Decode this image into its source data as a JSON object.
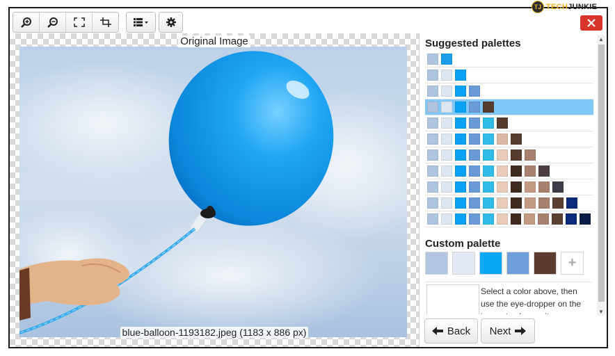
{
  "toolbar": {
    "buttons": [
      {
        "icon": "zoom-in-icon"
      },
      {
        "icon": "zoom-out-icon"
      },
      {
        "icon": "fit-screen-icon"
      },
      {
        "icon": "crop-icon"
      },
      {
        "icon": "list-dropdown-icon"
      },
      {
        "icon": "gear-icon"
      }
    ]
  },
  "logo": {
    "badge": "TJ",
    "text_part1": "TECH",
    "text_part2": "JUNKIE"
  },
  "close_icon": "close-icon",
  "image_panel": {
    "title": "Original Image",
    "caption": "blue-balloon-1193182.jpeg (1183 x 886 px)"
  },
  "suggested": {
    "title": "Suggested palettes",
    "selected_index": 3,
    "rows": [
      [
        "#aec4df",
        "#1d9de9"
      ],
      [
        "#aec4df",
        "#dde6f0",
        "#0ba1f2"
      ],
      [
        "#aec4df",
        "#dde6f0",
        "#0ba1f2",
        "#6a9ad6"
      ],
      [
        "#aec4df",
        "#dde6f0",
        "#0ba1f2",
        "#6a9ad6",
        "#553a2e"
      ],
      [
        "#aec4df",
        "#dde6f0",
        "#0ba1f2",
        "#6a9ad6",
        "#2fbde8",
        "#553a2e"
      ],
      [
        "#aec4df",
        "#dde6f0",
        "#0ba1f2",
        "#6a9ad6",
        "#2fbde8",
        "#dcb9a6",
        "#553a2e"
      ],
      [
        "#aec4df",
        "#dde6f0",
        "#0ba1f2",
        "#6a9ad6",
        "#2fbde8",
        "#e8cbb8",
        "#553a2e",
        "#a8806f"
      ],
      [
        "#aec4df",
        "#dde6f0",
        "#0ba1f2",
        "#6a9ad6",
        "#2fbde8",
        "#e8cbb8",
        "#3f2a20",
        "#a8806f",
        "#4b3f41"
      ],
      [
        "#aec4df",
        "#dde6f0",
        "#0ba1f2",
        "#6a9ad6",
        "#2fbde8",
        "#e8cbb8",
        "#3f2a20",
        "#c39a84",
        "#a8806f",
        "#3e3c48"
      ],
      [
        "#aec4df",
        "#dde6f0",
        "#0ba1f2",
        "#6a9ad6",
        "#2fbde8",
        "#e8cbb8",
        "#3f2a20",
        "#c39a84",
        "#a8806f",
        "#5a4032",
        "#0c2a7a"
      ],
      [
        "#aec4df",
        "#dde6f0",
        "#0ba1f2",
        "#6a9ad6",
        "#2fbde8",
        "#e8cbb8",
        "#3f2a20",
        "#c39a84",
        "#a8806f",
        "#5a4032",
        "#0c2a7a",
        "#0a1c45"
      ]
    ]
  },
  "custom": {
    "title": "Custom palette",
    "swatches": [
      "#b2c6e0",
      "#e2e9f2",
      "#0aa7f5",
      "#6e9fd8",
      "#5a3d2e"
    ],
    "add_label": "+"
  },
  "hint": "Select a color above, then use the eye-dropper on the image to change it.",
  "nav": {
    "back_label": "Back",
    "next_label": "Next"
  }
}
